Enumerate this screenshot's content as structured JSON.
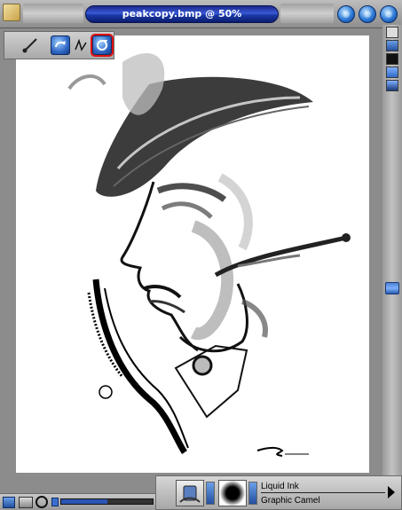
{
  "window": {
    "title": "peakcopy.bmp @ 50%"
  },
  "toolbar": {
    "tools": [
      "brush-tool",
      "rotate-tool",
      "lasso-tool",
      "selected-tool"
    ]
  },
  "brush": {
    "category": "Liquid Ink",
    "variant": "Graphic Camel"
  },
  "colors": {
    "title_blue": "#2a4ac2",
    "selection_red": "#e01010",
    "canvas": "#ffffff"
  }
}
